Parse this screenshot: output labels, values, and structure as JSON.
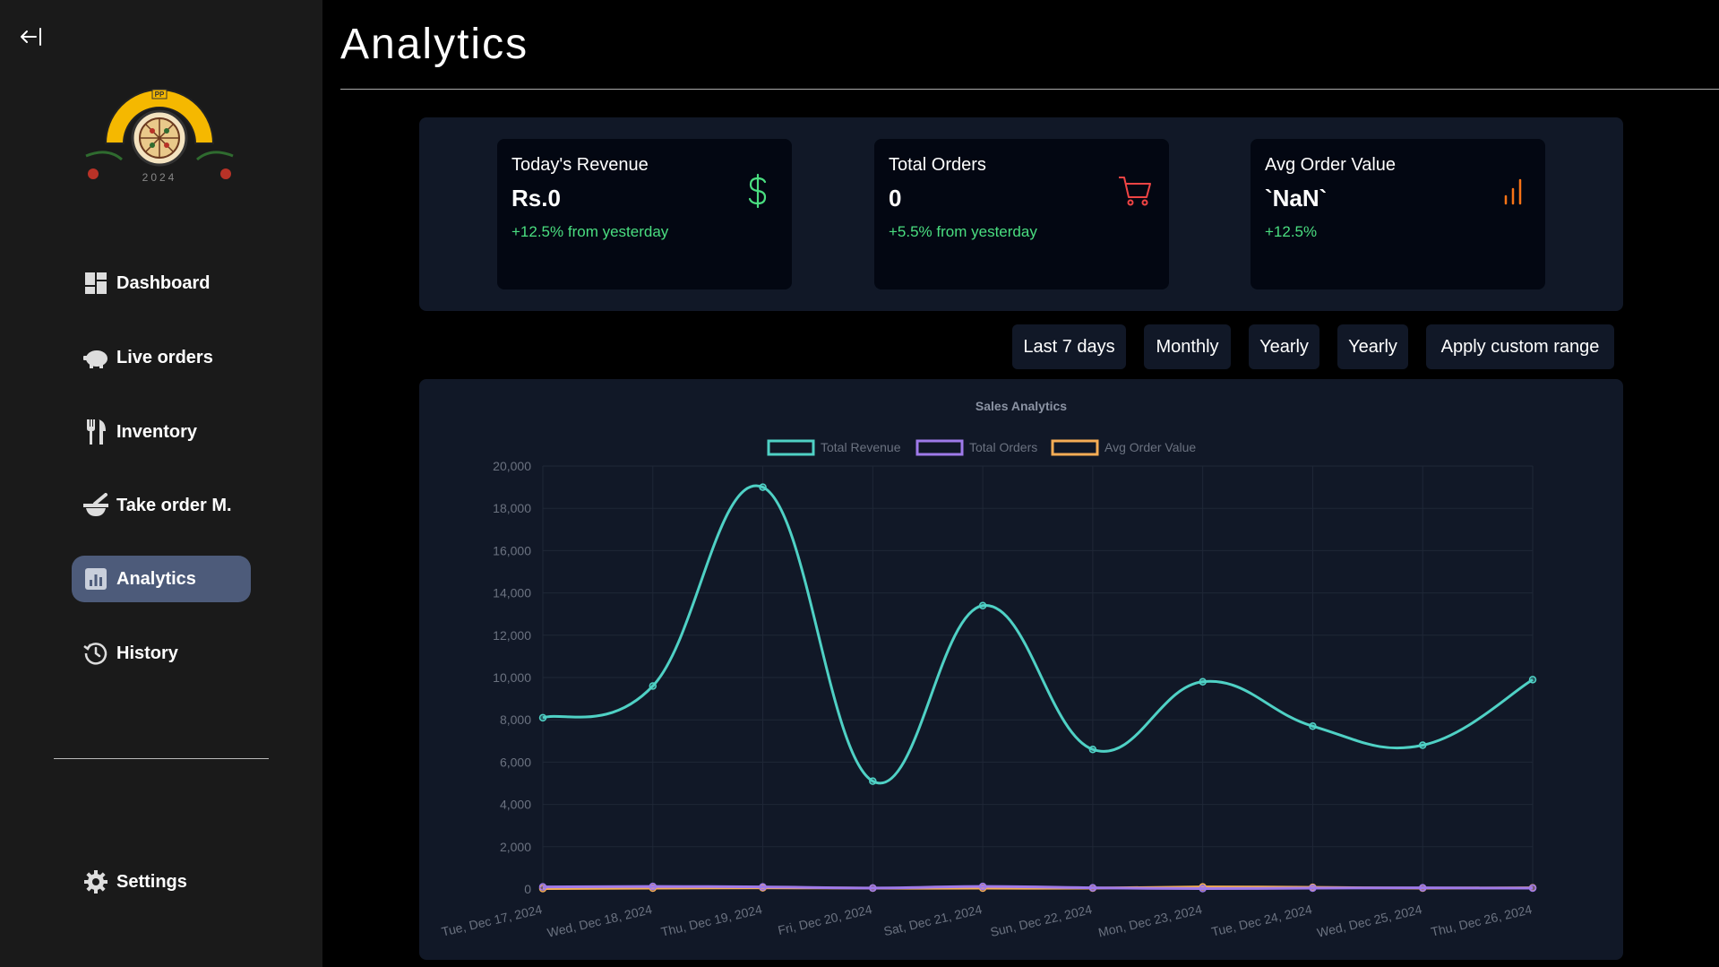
{
  "sidebar": {
    "items": [
      {
        "label": "Dashboard",
        "icon": "dashboard-icon"
      },
      {
        "label": "Live orders",
        "icon": "piggy-bank-icon"
      },
      {
        "label": "Inventory",
        "icon": "utensils-icon"
      },
      {
        "label": "Take order M.",
        "icon": "mortar-pestle-icon"
      },
      {
        "label": "Analytics",
        "icon": "analytics-icon",
        "active": true
      },
      {
        "label": "History",
        "icon": "history-icon"
      }
    ],
    "settings_label": "Settings",
    "logo_year": "2024",
    "logo_badge": "PP"
  },
  "header": {
    "title": "Analytics"
  },
  "stats": [
    {
      "title": "Today's Revenue",
      "value": "Rs.0",
      "change": "+12.5% from yesterday",
      "icon": "dollar-icon",
      "color": "#4ade80"
    },
    {
      "title": "Total Orders",
      "value": "0",
      "change": "+5.5% from yesterday",
      "icon": "cart-icon",
      "color": "#ef4444"
    },
    {
      "title": "Avg Order Value",
      "value": "`NaN`",
      "change": "+12.5%",
      "icon": "bar-chart-icon",
      "color": "#f97316"
    }
  ],
  "ranges": [
    "Last 7 days",
    "Monthly",
    "Yearly",
    "Yearly",
    "Apply custom range"
  ],
  "chart_data": {
    "type": "line",
    "title": "Sales Analytics",
    "categories": [
      "Tue, Dec 17, 2024",
      "Wed, Dec 18, 2024",
      "Thu, Dec 19, 2024",
      "Fri, Dec 20, 2024",
      "Sat, Dec 21, 2024",
      "Sun, Dec 22, 2024",
      "Mon, Dec 23, 2024",
      "Tue, Dec 24, 2024",
      "Wed, Dec 25, 2024",
      "Thu, Dec 26, 2024"
    ],
    "ylim": [
      0,
      20000
    ],
    "yticks": [
      0,
      2000,
      4000,
      6000,
      8000,
      10000,
      12000,
      14000,
      16000,
      18000,
      20000
    ],
    "ytick_labels": [
      "0",
      "2,000",
      "4,000",
      "6,000",
      "8,000",
      "10,000",
      "12,000",
      "14,000",
      "16,000",
      "18,000",
      "20,000"
    ],
    "legend_position": "top",
    "grid": true,
    "series": [
      {
        "name": "Total Revenue",
        "color": "#4fd1c5",
        "values": [
          8100,
          9600,
          19000,
          5100,
          13400,
          6600,
          9800,
          7700,
          6800,
          9900
        ]
      },
      {
        "name": "Total Orders",
        "color": "#9f7aea",
        "values": [
          100,
          120,
          100,
          50,
          120,
          60,
          20,
          40,
          60,
          40
        ]
      },
      {
        "name": "Avg Order Value",
        "color": "#f6ad55",
        "values": [
          20,
          40,
          60,
          40,
          40,
          40,
          100,
          80,
          40,
          60
        ]
      }
    ]
  }
}
